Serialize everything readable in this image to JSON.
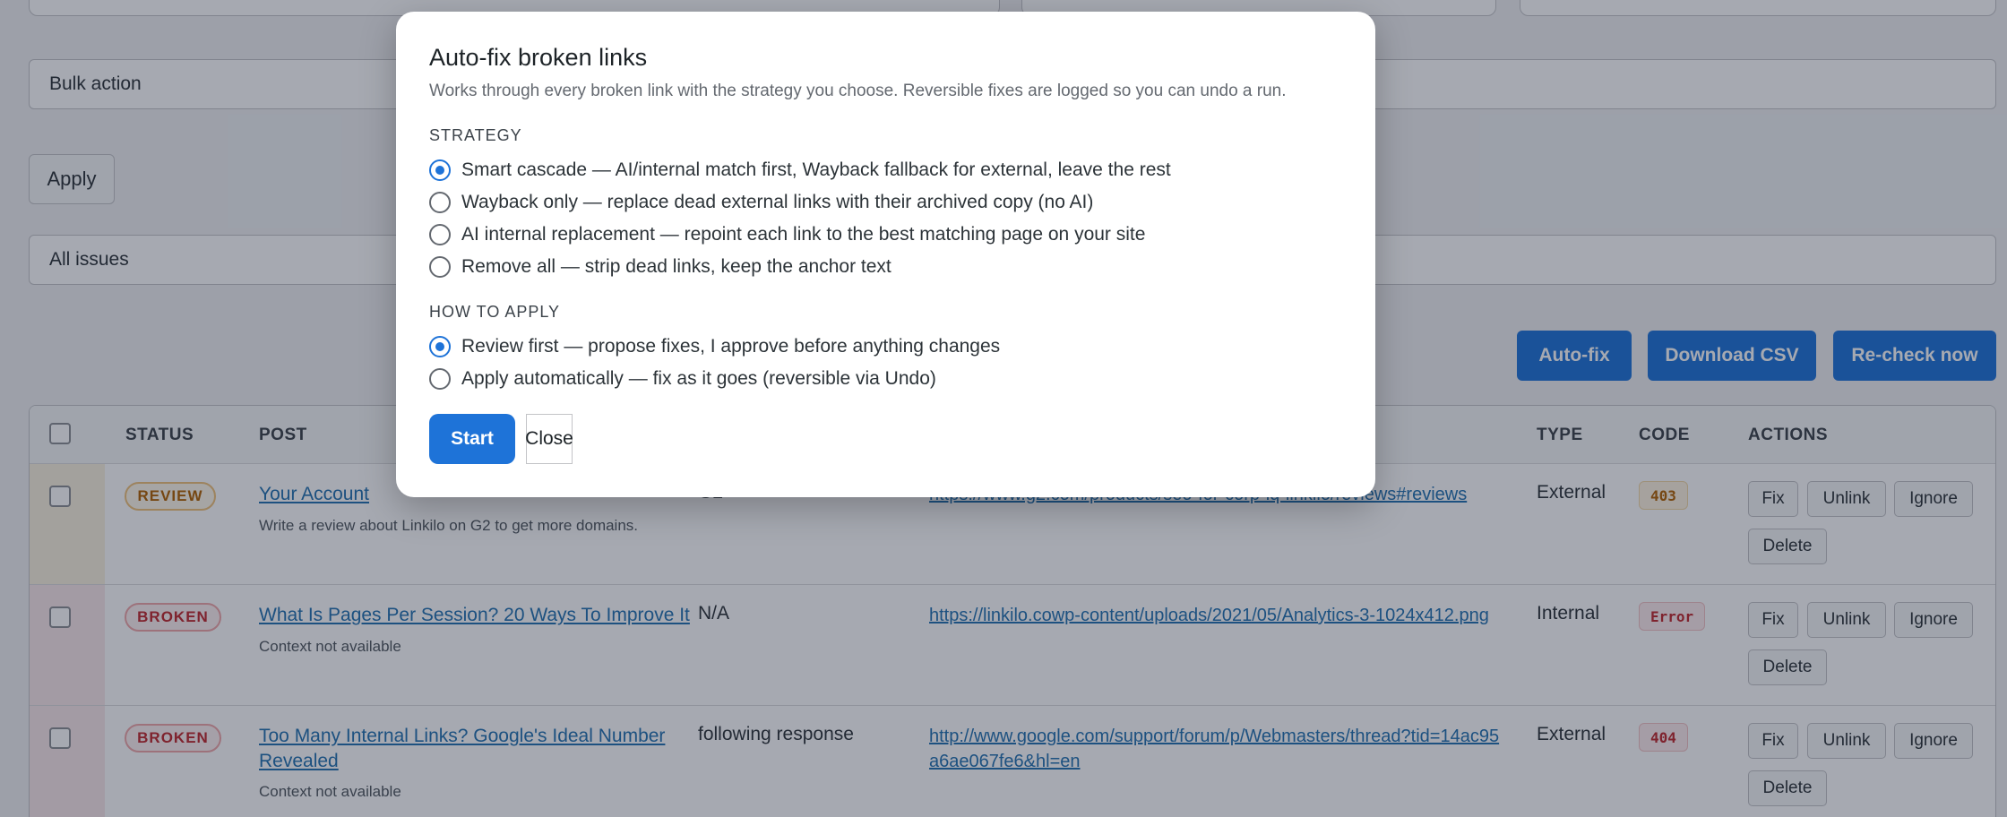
{
  "filters": {
    "bulk_action": "Bulk action",
    "apply_label": "Apply",
    "issue_filter": "All issues"
  },
  "toolbar": {
    "auto_fix": "Auto-fix",
    "download_csv": "Download CSV",
    "recheck": "Re-check now"
  },
  "table": {
    "headers": {
      "status": "STATUS",
      "post": "POST",
      "type": "TYPE",
      "code": "CODE",
      "actions": "ACTIONS"
    },
    "rows": [
      {
        "status": "REVIEW",
        "post_title": "Your Account",
        "post_context": "Write a review about Linkilo on G2 to get more domains.",
        "anchor": "G2",
        "url": "https://www.g2.com/products/seo-for-corp-iq-linkilo/reviews#reviews",
        "type": "External",
        "code": "403"
      },
      {
        "status": "BROKEN",
        "post_title": "What Is Pages Per Session? 20 Ways To Improve It",
        "post_context": "Context not available",
        "anchor": "N/A",
        "url": "https://linkilo.cowp-content/uploads/2021/05/Analytics-3-1024x412.png",
        "type": "Internal",
        "code": "Error"
      },
      {
        "status": "BROKEN",
        "post_title": "Too Many Internal Links? Google's Ideal Number Revealed",
        "post_context": "Context not available",
        "anchor": "following response",
        "url": "http://www.google.com/support/forum/p/Webmasters/thread?tid=14ac95a6ae067fe6&hl=en",
        "type": "External",
        "code": "404"
      }
    ],
    "row_actions": {
      "fix": "Fix",
      "unlink": "Unlink",
      "ignore": "Ignore",
      "delete": "Delete"
    }
  },
  "modal": {
    "title": "Auto-fix broken links",
    "description": "Works through every broken link with the strategy you choose. Reversible fixes are logged so you can undo a run.",
    "strategy_label": "STRATEGY",
    "strategies": [
      "Smart cascade — AI/internal match first, Wayback fallback for external, leave the rest",
      "Wayback only — replace dead external links with their archived copy (no AI)",
      "AI internal replacement — repoint each link to the best matching page on your site",
      "Remove all — strip dead links, keep the anchor text"
    ],
    "strategy_selected": 0,
    "apply_label": "HOW TO APPLY",
    "apply_modes": [
      "Review first — propose fixes, I approve before anything changes",
      "Apply automatically — fix as it goes (reversible via Undo)"
    ],
    "apply_selected": 0,
    "start": "Start",
    "close": "Close"
  },
  "colors": {
    "accent": "#1e73d8",
    "review": "#b26200",
    "broken": "#c0282d"
  }
}
